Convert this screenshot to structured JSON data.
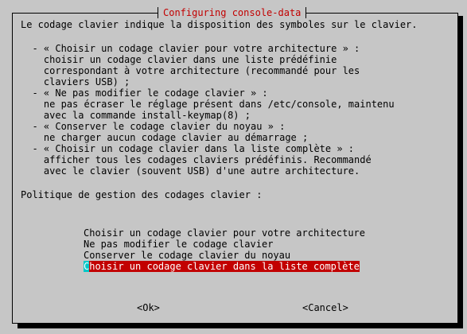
{
  "dialog": {
    "title": "Configuring console-data",
    "intro": "Le codage clavier indique la disposition des symboles sur le clavier.",
    "help_lines": [
      "  - « Choisir un codage clavier pour votre architecture » :",
      "    choisir un codage clavier dans une liste prédéfinie",
      "    correspondant à votre architecture (recommandé pour les",
      "    claviers USB) ;",
      "  - « Ne pas modifier le codage clavier » :",
      "    ne pas écraser le réglage présent dans /etc/console, maintenu",
      "    avec la commande install-keymap(8) ;",
      "  - « Conserver le codage clavier du noyau » :",
      "    ne charger aucun codage clavier au démarrage ;",
      "  - « Choisir un codage clavier dans la liste complète » :",
      "    afficher tous les codages claviers prédéfinis. Recommandé",
      "    avec le clavier (souvent USB) d'une autre architecture."
    ],
    "prompt": "Politique de gestion des codages clavier :",
    "options": [
      "Choisir un codage clavier pour votre architecture",
      "Ne pas modifier le codage clavier",
      "Conserver le codage clavier du noyau",
      "Choisir un codage clavier dans la liste complète"
    ],
    "selected_option_first_char": "C",
    "selected_option_rest": "hoisir un codage clavier dans la liste complète",
    "ok_label": "<Ok>",
    "cancel_label": "<Cancel>"
  },
  "colors": {
    "dialog_bg": "#c6c6c6",
    "title_fg": "#c20000",
    "selection_bg": "#c20000",
    "cursor_bg": "#00c8c8"
  }
}
